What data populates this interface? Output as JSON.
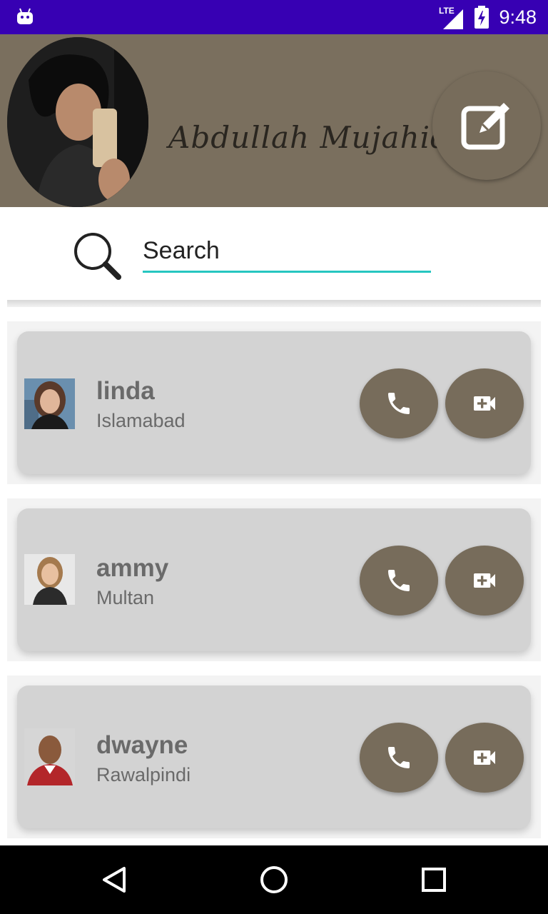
{
  "status_bar": {
    "network": "LTE",
    "time": "9:48",
    "background": "#3700b3"
  },
  "profile": {
    "name": "Abdullah Mujahid",
    "header_color": "#7a6f5e",
    "edit_icon": "edit-icon"
  },
  "search": {
    "placeholder": "Search",
    "underline_color": "#26c6c0",
    "icon": "search-icon"
  },
  "contacts": [
    {
      "name": "linda",
      "city": "Islamabad",
      "call_icon": "phone-icon",
      "video_icon": "video-call-icon"
    },
    {
      "name": "ammy",
      "city": "Multan",
      "call_icon": "phone-icon",
      "video_icon": "video-call-icon"
    },
    {
      "name": "dwayne",
      "city": "Rawalpindi",
      "call_icon": "phone-icon",
      "video_icon": "video-call-icon"
    }
  ],
  "nav": {
    "back_icon": "back-triangle-icon",
    "home_icon": "home-circle-icon",
    "recents_icon": "recents-square-icon"
  }
}
